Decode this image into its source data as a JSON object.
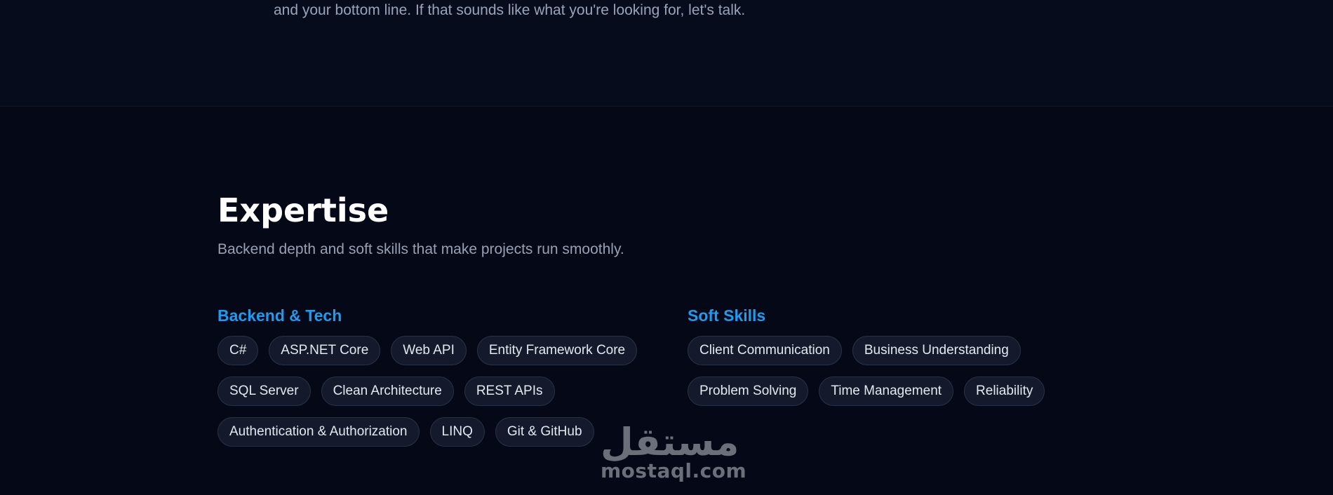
{
  "about": {
    "text": "and your bottom line. If that sounds like what you're looking for, let's talk."
  },
  "expertise": {
    "title": "Expertise",
    "subtitle": "Backend depth and soft skills that make projects run smoothly.",
    "backend": {
      "title": "Backend & Tech",
      "skills": [
        "C#",
        "ASP.NET Core",
        "Web API",
        "Entity Framework Core",
        "SQL Server",
        "Clean Architecture",
        "REST APIs",
        "Authentication & Authorization",
        "LINQ",
        "Git & GitHub"
      ]
    },
    "soft": {
      "title": "Soft Skills",
      "skills": [
        "Client Communication",
        "Business Understanding",
        "Problem Solving",
        "Time Management",
        "Reliability"
      ]
    }
  },
  "watermark": {
    "arabic": "مستقل",
    "latin": "mostaql.com"
  },
  "colors": {
    "background": "#050816",
    "accent": "#1d9bf0",
    "chip_background": "#141a2b",
    "chip_border": "#283246"
  }
}
